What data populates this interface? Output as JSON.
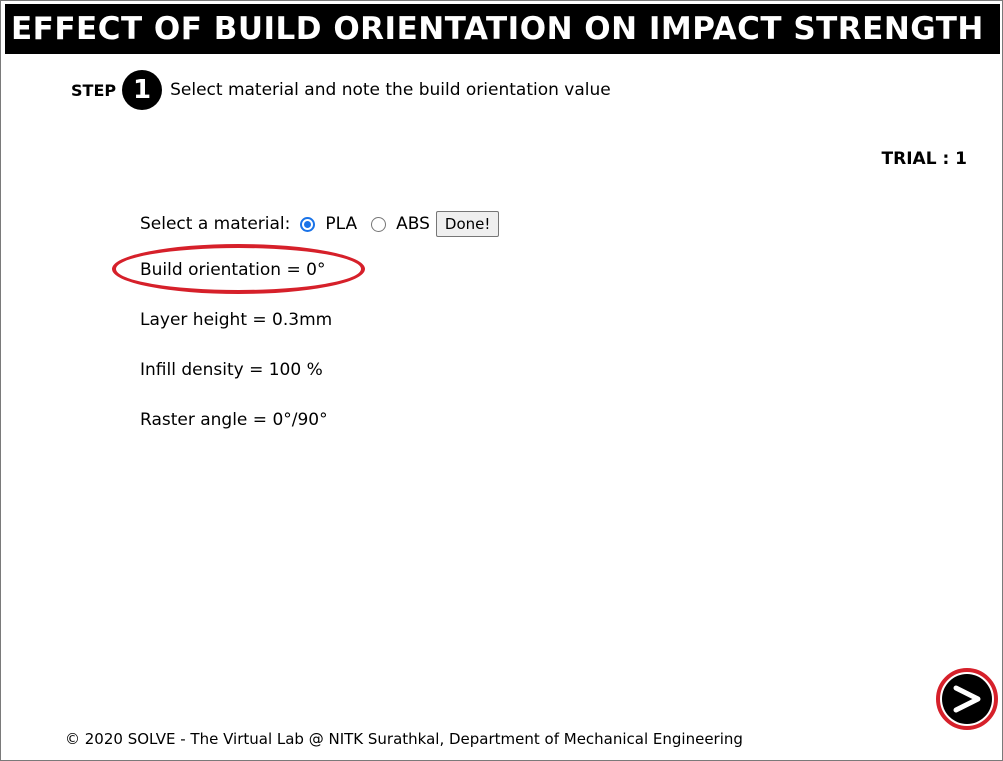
{
  "header": {
    "title": "EFFECT OF BUILD ORIENTATION ON IMPACT STRENGTH"
  },
  "step": {
    "label": "STEP",
    "number": "1",
    "instruction": "Select material and note the build orientation value"
  },
  "trial": {
    "text": "TRIAL : 1"
  },
  "material": {
    "label": "Select a material:",
    "options": [
      {
        "label": "PLA",
        "selected": true
      },
      {
        "label": "ABS",
        "selected": false
      }
    ],
    "done_label": "Done!"
  },
  "params": {
    "build_orientation": "Build orientation = 0°",
    "layer_height": "Layer height = 0.3mm",
    "infill_density": "Infill density = 100 %",
    "raster_angle": "Raster angle = 0°/90°"
  },
  "colors": {
    "title_bg": "#000000",
    "highlight": "#d6202a",
    "radio_accent": "#1a73e8"
  },
  "icons": {
    "next": "next-arrow-icon"
  },
  "footer": {
    "text": "© 2020 SOLVE - The Virtual Lab @ NITK Surathkal, Department of Mechanical Engineering"
  }
}
